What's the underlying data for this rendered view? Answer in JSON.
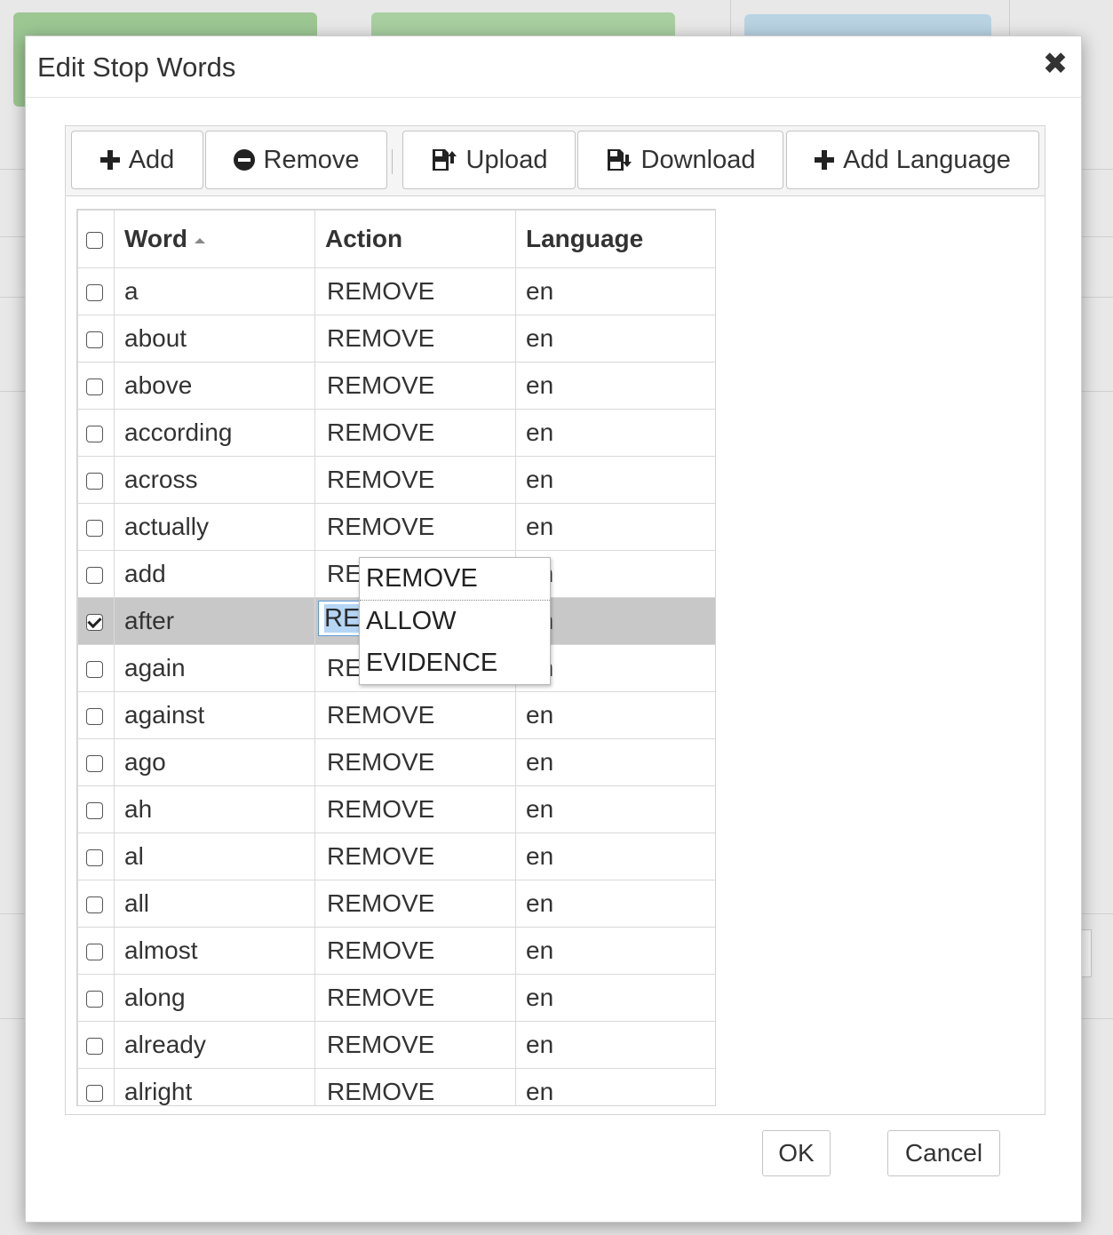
{
  "dialog": {
    "title": "Edit Stop Words",
    "close_icon": "close-icon"
  },
  "toolbar": {
    "add_label": "Add",
    "remove_label": "Remove",
    "upload_label": "Upload",
    "download_label": "Download",
    "add_language_label": "Add Language"
  },
  "table": {
    "columns": {
      "word": "Word",
      "action": "Action",
      "language": "Language"
    },
    "sort": {
      "column": "Word",
      "direction": "ascending"
    },
    "rows": [
      {
        "word": "a",
        "action": "REMOVE",
        "language": "en",
        "checked": false
      },
      {
        "word": "about",
        "action": "REMOVE",
        "language": "en",
        "checked": false
      },
      {
        "word": "above",
        "action": "REMOVE",
        "language": "en",
        "checked": false
      },
      {
        "word": "according",
        "action": "REMOVE",
        "language": "en",
        "checked": false
      },
      {
        "word": "across",
        "action": "REMOVE",
        "language": "en",
        "checked": false
      },
      {
        "word": "actually",
        "action": "REMOVE",
        "language": "en",
        "checked": false
      },
      {
        "word": "add",
        "action": "REMOVE",
        "language": "en",
        "checked": false
      },
      {
        "word": "after",
        "action": "REMOVE",
        "language": "en",
        "checked": true,
        "editing": true
      },
      {
        "word": "again",
        "action": "REMOVE",
        "language": "en",
        "checked": false
      },
      {
        "word": "against",
        "action": "REMOVE",
        "language": "en",
        "checked": false
      },
      {
        "word": "ago",
        "action": "REMOVE",
        "language": "en",
        "checked": false
      },
      {
        "word": "ah",
        "action": "REMOVE",
        "language": "en",
        "checked": false
      },
      {
        "word": "al",
        "action": "REMOVE",
        "language": "en",
        "checked": false
      },
      {
        "word": "all",
        "action": "REMOVE",
        "language": "en",
        "checked": false
      },
      {
        "word": "almost",
        "action": "REMOVE",
        "language": "en",
        "checked": false
      },
      {
        "word": "along",
        "action": "REMOVE",
        "language": "en",
        "checked": false
      },
      {
        "word": "already",
        "action": "REMOVE",
        "language": "en",
        "checked": false
      },
      {
        "word": "alright",
        "action": "REMOVE",
        "language": "en",
        "checked": false
      }
    ]
  },
  "action_dropdown": {
    "selected": "REMOVE",
    "options": [
      "REMOVE",
      "ALLOW",
      "EVIDENCE"
    ]
  },
  "footer": {
    "ok_label": "OK",
    "cancel_label": "Cancel"
  }
}
